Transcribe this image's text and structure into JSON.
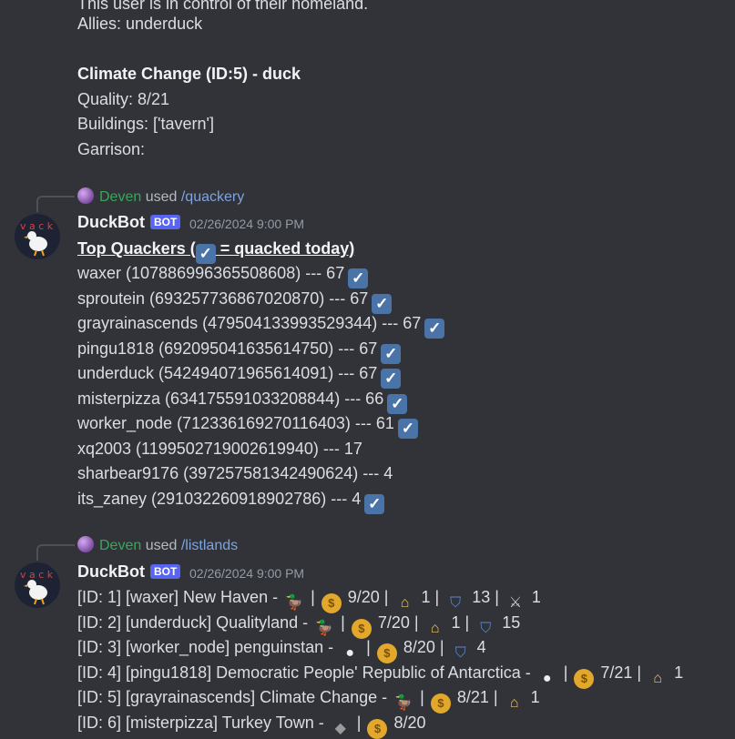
{
  "top": {
    "cut_line": "This user is in control of their homeland.",
    "allies": "Allies: underduck",
    "land_title": "Climate Change (ID:5) - duck",
    "quality": "Quality: 8/21",
    "buildings": "Buildings: ['tavern']",
    "garrison": "Garrison:"
  },
  "msg1": {
    "reply_user": "Deven",
    "reply_used": "used",
    "reply_cmd": "/quackery",
    "author": "DuckBot",
    "bot_tag": "BOT",
    "timestamp": "02/26/2024 9:00 PM",
    "title_pre": "Top Quackers (",
    "title_post": " = quacked today)",
    "rows": [
      {
        "text": "waxer (107886996365508608) --- 67",
        "check": true
      },
      {
        "text": "sproutein (693257736867020870) --- 67",
        "check": true
      },
      {
        "text": "grayrainascends (479504133993529344) --- 67",
        "check": true
      },
      {
        "text": "pingu1818 (692095041635614750) --- 67",
        "check": true
      },
      {
        "text": "underduck (542494071965614091) --- 67",
        "check": true
      },
      {
        "text": "misterpizza (634175591033208844) --- 66",
        "check": true
      },
      {
        "text": "worker_node (712336169270116403) --- 61",
        "check": true
      },
      {
        "text": "xq2003 (1199502719002619940) --- 17",
        "check": false
      },
      {
        "text": "sharbear9176 (397257581342490624) --- 4",
        "check": false
      },
      {
        "text": "its_zaney (291032260918902786) --- 4",
        "check": true
      }
    ]
  },
  "msg2": {
    "reply_user": "Deven",
    "reply_used": "used",
    "reply_cmd": "/listlands",
    "author": "DuckBot",
    "bot_tag": "BOT",
    "timestamp": "02/26/2024 9:00 PM",
    "lands": [
      {
        "pre": "[ID: 1] [waxer] New Haven - ",
        "tokens": [
          {
            "icon": "duck-icon"
          },
          {
            "sep": " | "
          },
          {
            "icon": "coin-icon"
          },
          {
            "t": " 9/20 | "
          },
          {
            "icon": "house-icon"
          },
          {
            "t": " 1 | "
          },
          {
            "icon": "shield-icon"
          },
          {
            "t": " 13 | "
          },
          {
            "icon": "swords-icon"
          },
          {
            "t": " 1"
          }
        ]
      },
      {
        "pre": "[ID: 2] [underduck] Qualityland - ",
        "tokens": [
          {
            "icon": "duck-icon"
          },
          {
            "sep": " | "
          },
          {
            "icon": "coin-icon"
          },
          {
            "t": " 7/20 | "
          },
          {
            "icon": "house-icon"
          },
          {
            "t": " 1 | "
          },
          {
            "icon": "shield-icon"
          },
          {
            "t": " 15"
          }
        ]
      },
      {
        "pre": "[ID: 3] [worker_node] penguinstan - ",
        "tokens": [
          {
            "icon": "penguin-icon"
          },
          {
            "sep": " | "
          },
          {
            "icon": "coin-icon"
          },
          {
            "t": " 8/20 | "
          },
          {
            "icon": "shield-icon"
          },
          {
            "t": " 4"
          }
        ]
      },
      {
        "pre": "[ID: 4] [pingu1818] Democratic People' Republic of Antarctica - ",
        "tokens": [
          {
            "icon": "penguin-icon"
          },
          {
            "sep": " | "
          },
          {
            "icon": "coin-icon"
          },
          {
            "t": " 7/21 | "
          },
          {
            "icon": "house-icon"
          },
          {
            "t": " 1"
          }
        ]
      },
      {
        "pre": "[ID: 5] [grayrainascends] Climate Change - ",
        "tokens": [
          {
            "icon": "duck-icon"
          },
          {
            "sep": " | "
          },
          {
            "icon": "coin-icon"
          },
          {
            "t": " 8/21 | "
          },
          {
            "icon": "house-icon"
          },
          {
            "t": " 1"
          }
        ]
      },
      {
        "pre": "[ID: 6] [misterpizza] Turkey Town - ",
        "tokens": [
          {
            "icon": "rat-icon"
          },
          {
            "sep": " | "
          },
          {
            "icon": "coin-icon"
          },
          {
            "t": " 8/20"
          }
        ]
      }
    ]
  },
  "icons": {
    "check": "✓",
    "duck-icon": "🦆",
    "coin-icon": "$",
    "house-icon": "⌂",
    "shield-icon": "⛉",
    "swords-icon": "⚔",
    "penguin-icon": "●",
    "rat-icon": "◆"
  },
  "colors": {
    "background": "#313338",
    "text": "#dbdee1",
    "username_green": "#3ba55c",
    "command_blue": "#7da3e0",
    "bot_tag": "#5865f2",
    "check_bg": "#4a73a8"
  }
}
